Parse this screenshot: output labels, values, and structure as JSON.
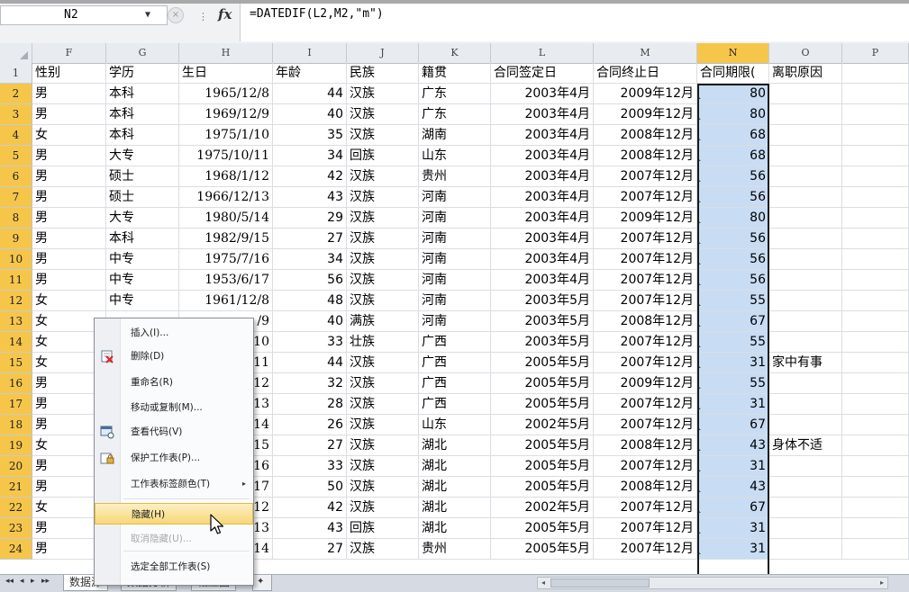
{
  "formula_bar": {
    "cell_ref": "N2",
    "formula": "=DATEDIF(L2,M2,\"m\")",
    "fx_label": "fx",
    "namebox_arrow": "▼",
    "cancel_glyph": "×",
    "handle_glyph": "⋮"
  },
  "columns": [
    "F",
    "G",
    "H",
    "I",
    "J",
    "K",
    "L",
    "M",
    "N",
    "O",
    "P"
  ],
  "selected_column": "N",
  "header_row": {
    "row": "1",
    "cells": [
      "性别",
      "学历",
      "生日",
      "年龄",
      "民族",
      "籍贯",
      "合同签定日",
      "合同终止日",
      "合同期限(",
      "离职原因",
      ""
    ]
  },
  "rows": [
    {
      "row": "2",
      "gender": "男",
      "edu": "本科",
      "birth": "1965/12/8",
      "age": "44",
      "ethnic": "汉族",
      "origin": "广东",
      "start": "2003年4月",
      "end": "2009年12月",
      "months": "80",
      "reason": ""
    },
    {
      "row": "3",
      "gender": "男",
      "edu": "本科",
      "birth": "1969/12/9",
      "age": "40",
      "ethnic": "汉族",
      "origin": "广东",
      "start": "2003年4月",
      "end": "2009年12月",
      "months": "80",
      "reason": ""
    },
    {
      "row": "4",
      "gender": "女",
      "edu": "本科",
      "birth": "1975/1/10",
      "age": "35",
      "ethnic": "汉族",
      "origin": "湖南",
      "start": "2003年4月",
      "end": "2008年12月",
      "months": "68",
      "reason": ""
    },
    {
      "row": "5",
      "gender": "男",
      "edu": "大专",
      "birth": "1975/10/11",
      "age": "34",
      "ethnic": "回族",
      "origin": "山东",
      "start": "2003年4月",
      "end": "2008年12月",
      "months": "68",
      "reason": ""
    },
    {
      "row": "6",
      "gender": "男",
      "edu": "硕士",
      "birth": "1968/1/12",
      "age": "42",
      "ethnic": "汉族",
      "origin": "贵州",
      "start": "2003年4月",
      "end": "2007年12月",
      "months": "56",
      "reason": ""
    },
    {
      "row": "7",
      "gender": "男",
      "edu": "硕士",
      "birth": "1966/12/13",
      "age": "43",
      "ethnic": "汉族",
      "origin": "河南",
      "start": "2003年4月",
      "end": "2007年12月",
      "months": "56",
      "reason": ""
    },
    {
      "row": "8",
      "gender": "男",
      "edu": "大专",
      "birth": "1980/5/14",
      "age": "29",
      "ethnic": "汉族",
      "origin": "河南",
      "start": "2003年4月",
      "end": "2009年12月",
      "months": "80",
      "reason": ""
    },
    {
      "row": "9",
      "gender": "男",
      "edu": "本科",
      "birth": "1982/9/15",
      "age": "27",
      "ethnic": "汉族",
      "origin": "河南",
      "start": "2003年4月",
      "end": "2007年12月",
      "months": "56",
      "reason": ""
    },
    {
      "row": "10",
      "gender": "男",
      "edu": "中专",
      "birth": "1975/7/16",
      "age": "34",
      "ethnic": "汉族",
      "origin": "河南",
      "start": "2003年4月",
      "end": "2007年12月",
      "months": "56",
      "reason": ""
    },
    {
      "row": "11",
      "gender": "男",
      "edu": "中专",
      "birth": "1953/6/17",
      "age": "56",
      "ethnic": "汉族",
      "origin": "河南",
      "start": "2003年4月",
      "end": "2007年12月",
      "months": "56",
      "reason": ""
    },
    {
      "row": "12",
      "gender": "女",
      "edu": "中专",
      "birth": "1961/12/8",
      "age": "48",
      "ethnic": "汉族",
      "origin": "河南",
      "start": "2003年5月",
      "end": "2007年12月",
      "months": "55",
      "reason": ""
    },
    {
      "row": "13",
      "gender": "女",
      "edu": "",
      "birth": "/9",
      "age": "40",
      "ethnic": "满族",
      "origin": "河南",
      "start": "2003年5月",
      "end": "2008年12月",
      "months": "67",
      "reason": ""
    },
    {
      "row": "14",
      "gender": "女",
      "edu": "",
      "birth": "10",
      "age": "33",
      "ethnic": "壮族",
      "origin": "广西",
      "start": "2003年5月",
      "end": "2007年12月",
      "months": "55",
      "reason": ""
    },
    {
      "row": "15",
      "gender": "女",
      "edu": "",
      "birth": "11",
      "age": "44",
      "ethnic": "汉族",
      "origin": "广西",
      "start": "2005年5月",
      "end": "2007年12月",
      "months": "31",
      "reason": "家中有事"
    },
    {
      "row": "16",
      "gender": "男",
      "edu": "",
      "birth": "12",
      "age": "32",
      "ethnic": "汉族",
      "origin": "广西",
      "start": "2005年5月",
      "end": "2009年12月",
      "months": "55",
      "reason": ""
    },
    {
      "row": "17",
      "gender": "男",
      "edu": "",
      "birth": "13",
      "age": "28",
      "ethnic": "汉族",
      "origin": "广西",
      "start": "2005年5月",
      "end": "2007年12月",
      "months": "31",
      "reason": ""
    },
    {
      "row": "18",
      "gender": "男",
      "edu": "",
      "birth": "14",
      "age": "26",
      "ethnic": "汉族",
      "origin": "山东",
      "start": "2002年5月",
      "end": "2007年12月",
      "months": "67",
      "reason": ""
    },
    {
      "row": "19",
      "gender": "女",
      "edu": "",
      "birth": "15",
      "age": "27",
      "ethnic": "汉族",
      "origin": "湖北",
      "start": "2005年5月",
      "end": "2008年12月",
      "months": "43",
      "reason": "身体不适"
    },
    {
      "row": "20",
      "gender": "男",
      "edu": "",
      "birth": "16",
      "age": "33",
      "ethnic": "汉族",
      "origin": "湖北",
      "start": "2005年5月",
      "end": "2007年12月",
      "months": "31",
      "reason": ""
    },
    {
      "row": "21",
      "gender": "男",
      "edu": "",
      "birth": "17",
      "age": "50",
      "ethnic": "汉族",
      "origin": "湖北",
      "start": "2005年5月",
      "end": "2008年12月",
      "months": "43",
      "reason": ""
    },
    {
      "row": "22",
      "gender": "女",
      "edu": "",
      "birth": "12",
      "age": "42",
      "ethnic": "汉族",
      "origin": "湖北",
      "start": "2002年5月",
      "end": "2007年12月",
      "months": "67",
      "reason": ""
    },
    {
      "row": "23",
      "gender": "男",
      "edu": "",
      "birth": "13",
      "age": "43",
      "ethnic": "回族",
      "origin": "湖北",
      "start": "2005年5月",
      "end": "2007年12月",
      "months": "31",
      "reason": ""
    },
    {
      "row": "24",
      "gender": "男",
      "edu": "",
      "birth": "14",
      "age": "27",
      "ethnic": "汉族",
      "origin": "贵州",
      "start": "2005年5月",
      "end": "2007年12月",
      "months": "31",
      "reason": ""
    }
  ],
  "context_menu": {
    "items": [
      {
        "label": "插入(I)...",
        "icon": "",
        "disabled": false,
        "highlighted": false,
        "submenu": false
      },
      {
        "label": "删除(D)",
        "icon": "delete-sheet-icon",
        "disabled": false,
        "highlighted": false,
        "submenu": false
      },
      {
        "label": "重命名(R)",
        "icon": "",
        "disabled": false,
        "highlighted": false,
        "submenu": false
      },
      {
        "label": "移动或复制(M)...",
        "icon": "",
        "disabled": false,
        "highlighted": false,
        "submenu": false
      },
      {
        "label": "查看代码(V)",
        "icon": "view-code-icon",
        "disabled": false,
        "highlighted": false,
        "submenu": false
      },
      {
        "label": "保护工作表(P)...",
        "icon": "protect-sheet-icon",
        "disabled": false,
        "highlighted": false,
        "submenu": false
      },
      {
        "label": "工作表标签颜色(T)",
        "icon": "",
        "disabled": false,
        "highlighted": false,
        "submenu": true
      },
      {
        "label": "隐藏(H)",
        "icon": "",
        "disabled": false,
        "highlighted": true,
        "submenu": false
      },
      {
        "label": "取消隐藏(U)...",
        "icon": "",
        "disabled": true,
        "highlighted": false,
        "submenu": false
      },
      {
        "label": "选定全部工作表(S)",
        "icon": "",
        "disabled": false,
        "highlighted": false,
        "submenu": false
      }
    ],
    "submenu_arrow": "▸"
  },
  "sheet_tabs": {
    "nav": [
      "◂◂",
      "◂",
      "▸",
      "▸▸"
    ],
    "tabs": [
      {
        "label": "数据源",
        "active": true
      },
      {
        "label": "数据分析",
        "active": false
      },
      {
        "label": "相应图",
        "active": false
      }
    ],
    "new_sheet_glyph": "✦"
  },
  "colors": {
    "selection_fill": "#c8dcf4",
    "header_highlight": "#f6c64b",
    "menu_highlight": "#f7d978",
    "header_bg": "#e8ebf0"
  }
}
